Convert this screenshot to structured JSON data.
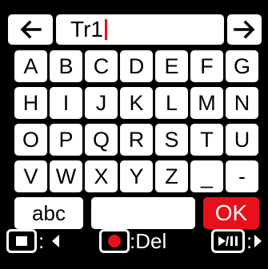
{
  "entry": {
    "text": "Tr1"
  },
  "rows": [
    [
      "A",
      "B",
      "C",
      "D",
      "E",
      "F",
      "G"
    ],
    [
      "H",
      "I",
      "J",
      "K",
      "L",
      "M",
      "N"
    ],
    [
      "O",
      "P",
      "Q",
      "R",
      "S",
      "T",
      "U"
    ],
    [
      "V",
      "W",
      "X",
      "Y",
      "Z",
      "_",
      "-"
    ]
  ],
  "bottom": {
    "abc_label": "abc",
    "ok_label": "OK"
  },
  "hints": {
    "stop_colon": ":",
    "rec_label": ":Del",
    "play_colon": ":"
  },
  "colors": {
    "accent": "#e8101a",
    "key_bg": "#ffffff",
    "screen_bg": "#000000"
  }
}
